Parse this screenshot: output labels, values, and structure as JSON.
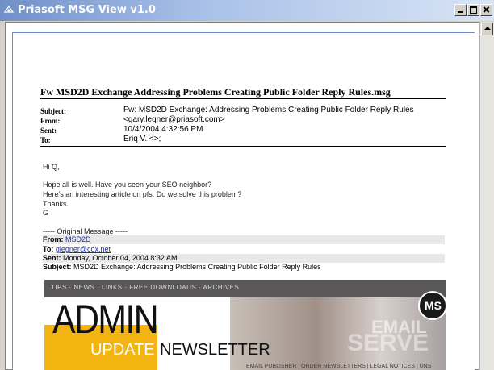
{
  "window": {
    "title": "Priasoft MSG View v1.0",
    "icon": "app-icon"
  },
  "message": {
    "file_title": "Fw  MSD2D Exchange  Addressing Problems Creating Public Folder Reply Rules.msg",
    "headers": [
      {
        "label": "Subject:",
        "value": "Fw: MSD2D Exchange: Addressing Problems Creating Public Folder Reply Rules"
      },
      {
        "label": "From:",
        "value": "<gary.legner@priasoft.com>"
      },
      {
        "label": "Sent:",
        "value": "10/4/2004 4:32:56 PM"
      },
      {
        "label": "To:",
        "value": "Eriq V. <>;"
      }
    ],
    "body_lines": [
      "Hi Q,",
      "Hope all is well. Have you seen your SEO neighbor?",
      "Here's an interesting article on pfs.   Do we solve this problem?",
      "Thanks",
      "G"
    ],
    "original_separator": "----- Original Message -----",
    "original": {
      "from_label": "From:",
      "from_value": "MSD2D",
      "to_label": "To:",
      "to_value": "glegner@cox.net",
      "sent_label": "Sent:",
      "sent_value": "Monday, October 04, 2004 8:32 AM",
      "subject_label": "Subject:",
      "subject_value": "MSD2D Exchange: Addressing Problems Creating Public Folder Reply Rules"
    }
  },
  "banner": {
    "nav": "TIPS  ·  NEWS  ·  LINKS  ·  FREE DOWNLOADS  ·  ARCHIVES",
    "admin": "ADMIN",
    "update": "UPDATE",
    "newsletter": "NEWSLETTER",
    "email_word": "EMAIL",
    "server_word": "SERVE",
    "logo": "MS",
    "footer": "EMAIL PUBLISHER  |  ORDER NEWSLETTERS  |  LEGAL NOTICES  |  UNS"
  }
}
